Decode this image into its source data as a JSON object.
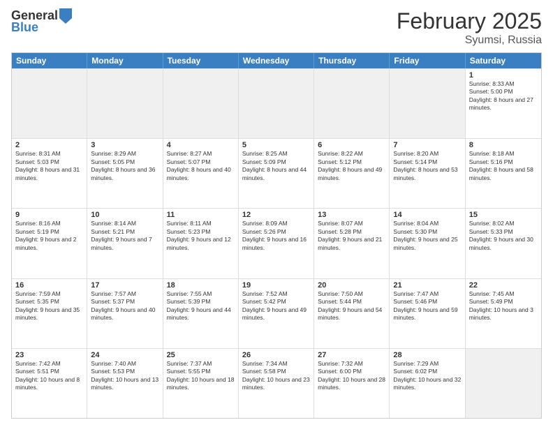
{
  "header": {
    "logo_general": "General",
    "logo_blue": "Blue",
    "title": "February 2025",
    "subtitle": "Syumsi, Russia"
  },
  "days_of_week": [
    "Sunday",
    "Monday",
    "Tuesday",
    "Wednesday",
    "Thursday",
    "Friday",
    "Saturday"
  ],
  "weeks": [
    [
      {
        "day": "",
        "info": "",
        "shaded": true
      },
      {
        "day": "",
        "info": "",
        "shaded": true
      },
      {
        "day": "",
        "info": "",
        "shaded": true
      },
      {
        "day": "",
        "info": "",
        "shaded": true
      },
      {
        "day": "",
        "info": "",
        "shaded": true
      },
      {
        "day": "",
        "info": "",
        "shaded": true
      },
      {
        "day": "1",
        "info": "Sunrise: 8:33 AM\nSunset: 5:00 PM\nDaylight: 8 hours and 27 minutes."
      }
    ],
    [
      {
        "day": "2",
        "info": "Sunrise: 8:31 AM\nSunset: 5:03 PM\nDaylight: 8 hours and 31 minutes."
      },
      {
        "day": "3",
        "info": "Sunrise: 8:29 AM\nSunset: 5:05 PM\nDaylight: 8 hours and 36 minutes."
      },
      {
        "day": "4",
        "info": "Sunrise: 8:27 AM\nSunset: 5:07 PM\nDaylight: 8 hours and 40 minutes."
      },
      {
        "day": "5",
        "info": "Sunrise: 8:25 AM\nSunset: 5:09 PM\nDaylight: 8 hours and 44 minutes."
      },
      {
        "day": "6",
        "info": "Sunrise: 8:22 AM\nSunset: 5:12 PM\nDaylight: 8 hours and 49 minutes."
      },
      {
        "day": "7",
        "info": "Sunrise: 8:20 AM\nSunset: 5:14 PM\nDaylight: 8 hours and 53 minutes."
      },
      {
        "day": "8",
        "info": "Sunrise: 8:18 AM\nSunset: 5:16 PM\nDaylight: 8 hours and 58 minutes."
      }
    ],
    [
      {
        "day": "9",
        "info": "Sunrise: 8:16 AM\nSunset: 5:19 PM\nDaylight: 9 hours and 2 minutes."
      },
      {
        "day": "10",
        "info": "Sunrise: 8:14 AM\nSunset: 5:21 PM\nDaylight: 9 hours and 7 minutes."
      },
      {
        "day": "11",
        "info": "Sunrise: 8:11 AM\nSunset: 5:23 PM\nDaylight: 9 hours and 12 minutes."
      },
      {
        "day": "12",
        "info": "Sunrise: 8:09 AM\nSunset: 5:26 PM\nDaylight: 9 hours and 16 minutes."
      },
      {
        "day": "13",
        "info": "Sunrise: 8:07 AM\nSunset: 5:28 PM\nDaylight: 9 hours and 21 minutes."
      },
      {
        "day": "14",
        "info": "Sunrise: 8:04 AM\nSunset: 5:30 PM\nDaylight: 9 hours and 25 minutes."
      },
      {
        "day": "15",
        "info": "Sunrise: 8:02 AM\nSunset: 5:33 PM\nDaylight: 9 hours and 30 minutes."
      }
    ],
    [
      {
        "day": "16",
        "info": "Sunrise: 7:59 AM\nSunset: 5:35 PM\nDaylight: 9 hours and 35 minutes."
      },
      {
        "day": "17",
        "info": "Sunrise: 7:57 AM\nSunset: 5:37 PM\nDaylight: 9 hours and 40 minutes."
      },
      {
        "day": "18",
        "info": "Sunrise: 7:55 AM\nSunset: 5:39 PM\nDaylight: 9 hours and 44 minutes."
      },
      {
        "day": "19",
        "info": "Sunrise: 7:52 AM\nSunset: 5:42 PM\nDaylight: 9 hours and 49 minutes."
      },
      {
        "day": "20",
        "info": "Sunrise: 7:50 AM\nSunset: 5:44 PM\nDaylight: 9 hours and 54 minutes."
      },
      {
        "day": "21",
        "info": "Sunrise: 7:47 AM\nSunset: 5:46 PM\nDaylight: 9 hours and 59 minutes."
      },
      {
        "day": "22",
        "info": "Sunrise: 7:45 AM\nSunset: 5:49 PM\nDaylight: 10 hours and 3 minutes."
      }
    ],
    [
      {
        "day": "23",
        "info": "Sunrise: 7:42 AM\nSunset: 5:51 PM\nDaylight: 10 hours and 8 minutes."
      },
      {
        "day": "24",
        "info": "Sunrise: 7:40 AM\nSunset: 5:53 PM\nDaylight: 10 hours and 13 minutes."
      },
      {
        "day": "25",
        "info": "Sunrise: 7:37 AM\nSunset: 5:55 PM\nDaylight: 10 hours and 18 minutes."
      },
      {
        "day": "26",
        "info": "Sunrise: 7:34 AM\nSunset: 5:58 PM\nDaylight: 10 hours and 23 minutes."
      },
      {
        "day": "27",
        "info": "Sunrise: 7:32 AM\nSunset: 6:00 PM\nDaylight: 10 hours and 28 minutes."
      },
      {
        "day": "28",
        "info": "Sunrise: 7:29 AM\nSunset: 6:02 PM\nDaylight: 10 hours and 32 minutes."
      },
      {
        "day": "",
        "info": "",
        "shaded": true
      }
    ]
  ]
}
